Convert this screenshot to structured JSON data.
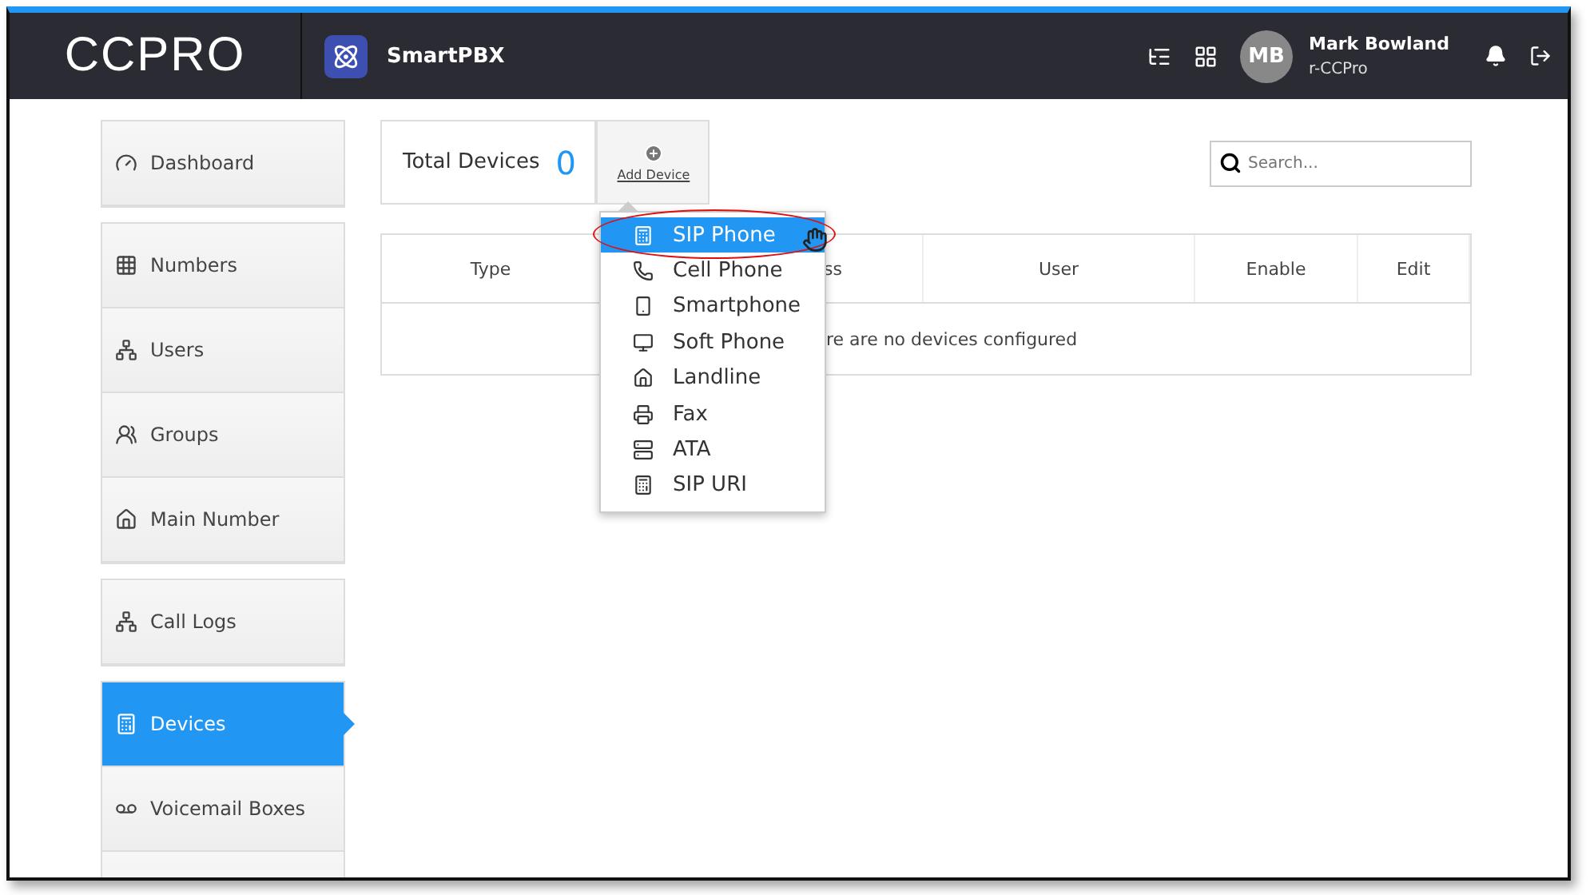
{
  "header": {
    "logo": "CCPRO",
    "app_name": "SmartPBX",
    "user": {
      "initials": "MB",
      "name": "Mark Bowland",
      "account": "r-CCPro"
    }
  },
  "sidebar": {
    "groups": [
      {
        "items": [
          {
            "label": "Dashboard",
            "selected": false
          }
        ]
      },
      {
        "items": [
          {
            "label": "Numbers",
            "selected": false
          },
          {
            "label": "Users",
            "selected": false
          },
          {
            "label": "Groups",
            "selected": false
          },
          {
            "label": "Main Number",
            "selected": false
          }
        ]
      },
      {
        "items": [
          {
            "label": "Call Logs",
            "selected": false
          }
        ]
      },
      {
        "items": [
          {
            "label": "Devices",
            "selected": true
          },
          {
            "label": "Voicemail Boxes",
            "selected": false
          }
        ]
      }
    ]
  },
  "summary": {
    "label": "Total Devices",
    "count": "0",
    "add_button": "Add Device"
  },
  "search": {
    "placeholder": "Search..."
  },
  "table": {
    "columns": [
      "Type",
      "ss",
      "User",
      "Enable",
      "Edit"
    ],
    "empty_message": "re are no devices configured"
  },
  "add_menu": {
    "items": [
      {
        "label": "SIP Phone",
        "selected": true
      },
      {
        "label": "Cell Phone",
        "selected": false
      },
      {
        "label": "Smartphone",
        "selected": false
      },
      {
        "label": "Soft Phone",
        "selected": false
      },
      {
        "label": "Landline",
        "selected": false
      },
      {
        "label": "Fax",
        "selected": false
      },
      {
        "label": "ATA",
        "selected": false
      },
      {
        "label": "SIP URI",
        "selected": false
      }
    ]
  }
}
